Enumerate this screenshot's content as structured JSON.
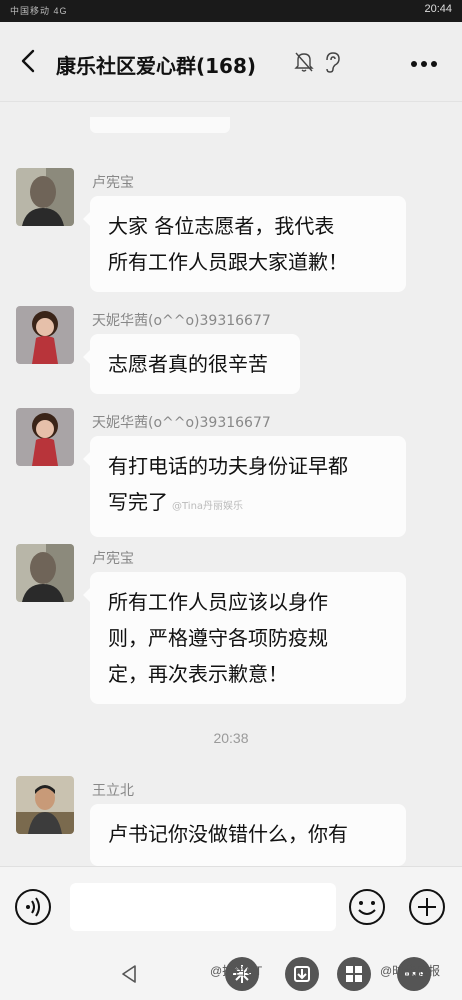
{
  "status_bar": {
    "left_text": "中国移动 4G",
    "right_text": "20:44"
  },
  "header": {
    "title": "康乐社区爱心群(168)"
  },
  "messages": [
    {
      "sender": "卢宪宝",
      "lines": [
        "大家 各位志愿者，我代表",
        "所有工作人员跟大家道歉！"
      ]
    },
    {
      "sender": "天妮华茜(o^^o)39316677",
      "lines": [
        "志愿者真的很辛苦"
      ]
    },
    {
      "sender": "天妮华茜(o^^o)39316677",
      "lines": [
        "有打电话的功夫身份证早都",
        "写完了"
      ],
      "inline_watermark": "@Tina丹丽娱乐"
    },
    {
      "sender": "卢宪宝",
      "lines": [
        "所有工作人员应该以身作",
        "则，严格遵守各项防疫规",
        "定，再次表示歉意！"
      ]
    },
    {
      "sender": "王立北",
      "lines": [
        "卢书记你没做错什么，你有"
      ]
    }
  ],
  "time_divider": "20:38",
  "watermarks": {
    "left": "@拆台CT",
    "right": "@时代周报"
  },
  "icons": {
    "back": "chevron-left-icon",
    "mute": "bell-off-icon",
    "ear": "ear-icon",
    "more": "more-horizontal-icon",
    "voice": "voice-icon",
    "emoji": "smile-icon",
    "plus": "plus-circle-icon"
  }
}
